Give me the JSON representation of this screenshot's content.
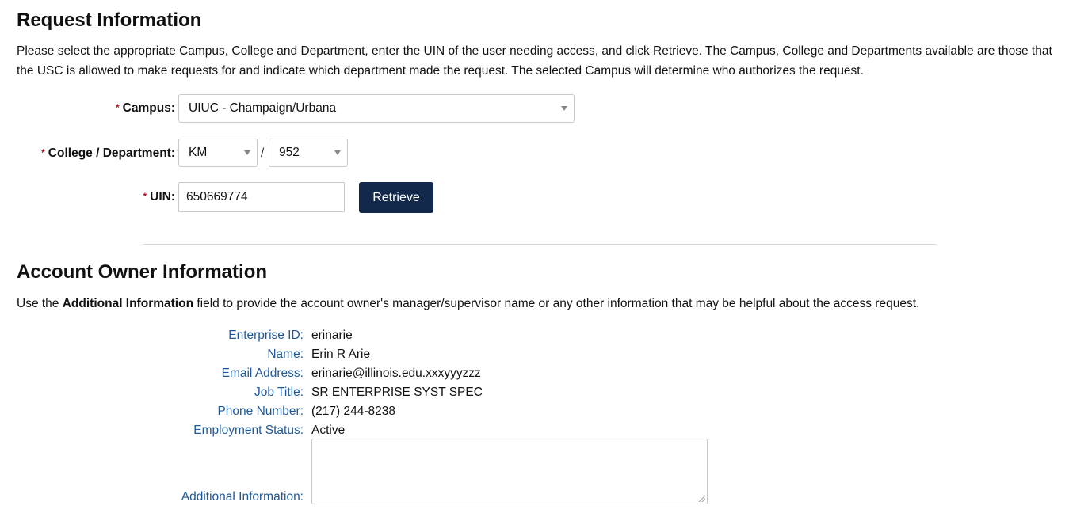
{
  "request_info": {
    "heading": "Request Information",
    "intro": "Please select the appropriate Campus, College and Department, enter the UIN of the user needing access, and click Retrieve. The Campus, College and Departments available are those that the USC is allowed to make requests for and indicate which department made the request. The selected Campus will determine who authorizes the request.",
    "required_mark": "*",
    "campus_label": "Campus:",
    "campus_value": "UIUC - Champaign/Urbana",
    "college_dept_label": "College / Department:",
    "college_value": "KM",
    "separator": "/",
    "department_value": "952",
    "uin_label": "UIN:",
    "uin_value": "650669774",
    "retrieve_label": "Retrieve"
  },
  "account_owner": {
    "heading": "Account Owner Information",
    "intro_prefix": "Use the ",
    "intro_bold": "Additional Information",
    "intro_suffix": " field to provide the account owner's manager/supervisor name or any other information that may be helpful about the access request.",
    "fields": [
      {
        "label": "Enterprise ID:",
        "value": "erinarie"
      },
      {
        "label": "Name:",
        "value": "Erin R Arie"
      },
      {
        "label": "Email Address:",
        "value": "erinarie@illinois.edu.xxxyyyzzz"
      },
      {
        "label": "Job Title:",
        "value": "SR ENTERPRISE SYST SPEC"
      },
      {
        "label": "Phone Number:",
        "value": "(217) 244-8238"
      },
      {
        "label": "Employment Status:",
        "value": "Active"
      }
    ],
    "additional_info_label": "Additional Information:",
    "additional_info_value": ""
  }
}
